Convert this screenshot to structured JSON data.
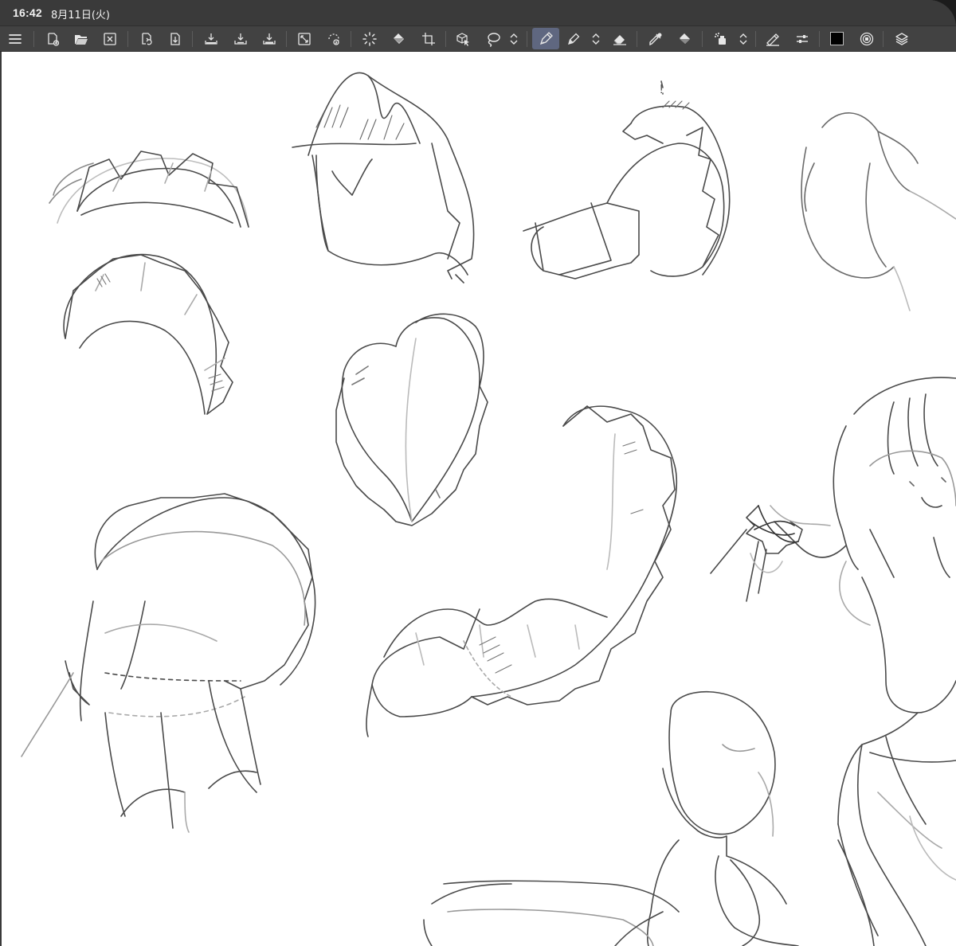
{
  "status": {
    "time": "16:42",
    "date": "8月11日(火)"
  },
  "toolbar": {
    "buttons": [
      {
        "name": "menu-icon",
        "interactable": true
      },
      {
        "name": "new-canvas-icon",
        "interactable": true
      },
      {
        "name": "open-file-icon",
        "interactable": true
      },
      {
        "name": "close-file-icon",
        "interactable": true
      },
      {
        "name": "undo-icon",
        "interactable": true
      },
      {
        "name": "redo-icon",
        "interactable": true
      },
      {
        "name": "export-icon",
        "interactable": true
      },
      {
        "name": "download-icon",
        "interactable": true
      },
      {
        "name": "save-icon",
        "interactable": true
      },
      {
        "name": "fit-view-icon",
        "interactable": true
      },
      {
        "name": "rotate-view-icon",
        "interactable": true
      },
      {
        "name": "loading-icon",
        "interactable": true
      },
      {
        "name": "fill-tool-icon",
        "interactable": true
      },
      {
        "name": "transform-icon",
        "interactable": true
      },
      {
        "name": "object-select-icon",
        "interactable": true
      },
      {
        "name": "lasso-icon",
        "interactable": true
      },
      {
        "name": "tool-switch-chevron-icon",
        "interactable": true
      },
      {
        "name": "pen-tool-icon",
        "interactable": true
      },
      {
        "name": "pencil-tool-icon",
        "interactable": true
      },
      {
        "name": "brush-switch-chevron-icon",
        "interactable": true
      },
      {
        "name": "eraser-icon",
        "interactable": true
      },
      {
        "name": "eyedropper-icon",
        "interactable": true
      },
      {
        "name": "bucket-icon",
        "interactable": true
      },
      {
        "name": "airbrush-icon",
        "interactable": true
      },
      {
        "name": "airbrush-switch-chevron-icon",
        "interactable": true
      },
      {
        "name": "ruler-pen-icon",
        "interactable": true
      },
      {
        "name": "settings-sliders-icon",
        "interactable": true
      },
      {
        "name": "color-swatch",
        "interactable": true
      },
      {
        "name": "color-wheel-icon",
        "interactable": true
      },
      {
        "name": "layers-icon",
        "interactable": true
      }
    ],
    "active_tool": "pen-tool-icon",
    "current_color": "#000000",
    "accent_active": "#5f6780"
  },
  "canvas": {
    "background": "#ffffff",
    "sketch_stroke": "#4a4a4a",
    "annotation_text": "!"
  }
}
